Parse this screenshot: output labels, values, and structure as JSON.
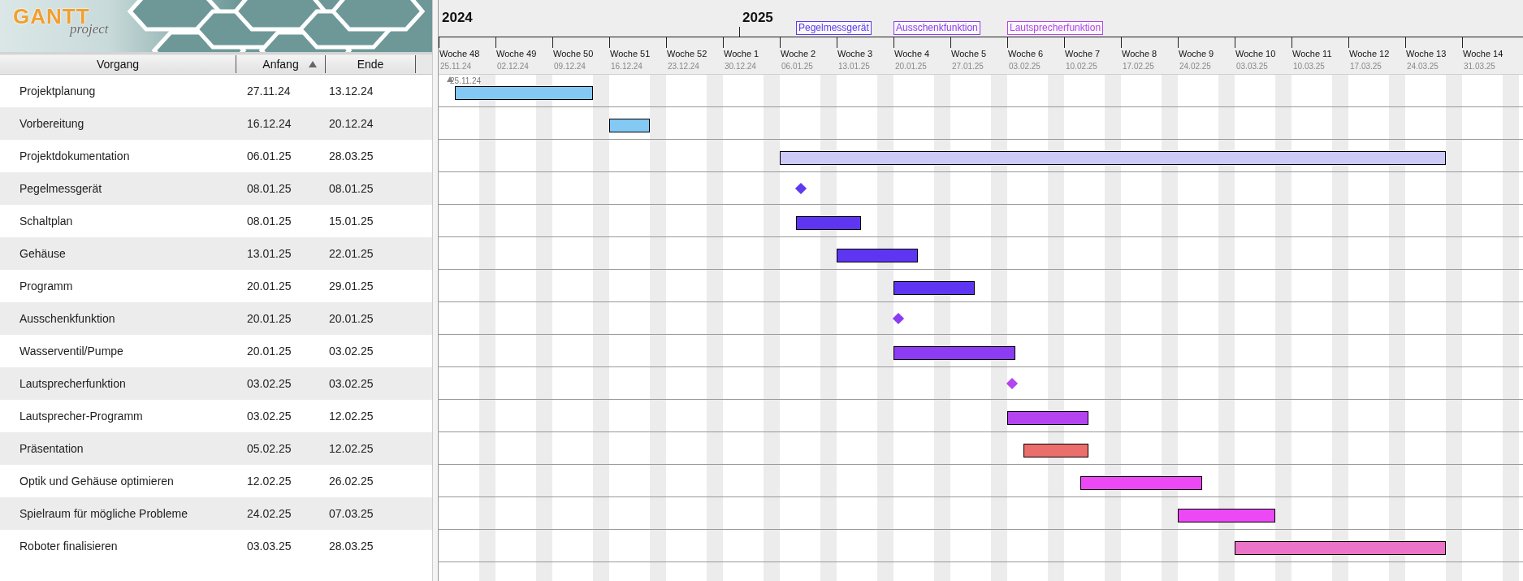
{
  "logo": {
    "title": "GANTT",
    "subtitle": "project"
  },
  "table": {
    "columns": [
      {
        "label": "Vorgang",
        "sorted": false
      },
      {
        "label": "Anfang",
        "sorted": true
      },
      {
        "label": "Ende",
        "sorted": false
      }
    ],
    "rows": [
      {
        "name": "Projektplanung",
        "start": "27.11.24",
        "end": "13.12.24",
        "kind": "task",
        "color": "#84c8f4"
      },
      {
        "name": "Vorbereitung",
        "start": "16.12.24",
        "end": "20.12.24",
        "kind": "task",
        "color": "#84c8f4"
      },
      {
        "name": "Projektdokumentation",
        "start": "06.01.25",
        "end": "28.03.25",
        "kind": "task",
        "color": "#cccaf6"
      },
      {
        "name": "Pegelmessgerät",
        "start": "08.01.25",
        "end": "08.01.25",
        "kind": "milestone",
        "color": "#5e3af0"
      },
      {
        "name": "Schaltplan",
        "start": "08.01.25",
        "end": "15.01.25",
        "kind": "task",
        "color": "#5e36f2"
      },
      {
        "name": "Gehäuse",
        "start": "13.01.25",
        "end": "22.01.25",
        "kind": "task",
        "color": "#5e36f2"
      },
      {
        "name": "Programm",
        "start": "20.01.25",
        "end": "29.01.25",
        "kind": "task",
        "color": "#5e36f2"
      },
      {
        "name": "Ausschenkfunktion",
        "start": "20.01.25",
        "end": "20.01.25",
        "kind": "milestone",
        "color": "#8c3cf0"
      },
      {
        "name": "Wasserventil/Pumpe",
        "start": "20.01.25",
        "end": "03.02.25",
        "kind": "task",
        "color": "#8c3cf2"
      },
      {
        "name": "Lautsprecherfunktion",
        "start": "03.02.25",
        "end": "03.02.25",
        "kind": "milestone",
        "color": "#b444ee"
      },
      {
        "name": "Lautsprecher-Programm",
        "start": "03.02.25",
        "end": "12.02.25",
        "kind": "task",
        "color": "#b444f0"
      },
      {
        "name": "Präsentation",
        "start": "05.02.25",
        "end": "12.02.25",
        "kind": "task",
        "color": "#ec6e6c"
      },
      {
        "name": "Optik und Gehäuse optimieren",
        "start": "12.02.25",
        "end": "26.02.25",
        "kind": "task",
        "color": "#ec48f6"
      },
      {
        "name": "Spielraum für mögliche Probleme",
        "start": "24.02.25",
        "end": "07.03.25",
        "kind": "task",
        "color": "#ec48f6"
      },
      {
        "name": "Roboter finalisieren",
        "start": "03.03.25",
        "end": "28.03.25",
        "kind": "task",
        "color": "#ec74c8"
      }
    ]
  },
  "timeline": {
    "years": [
      "2024",
      "2025"
    ],
    "milestone_labels": [
      "Pegelmessgerät",
      "Ausschenkfunktion",
      "Lautsprecherfunktion"
    ],
    "start_marker": "25.11.24",
    "weeks": [
      {
        "label": "Woche 48",
        "date": "25.11.24"
      },
      {
        "label": "Woche 49",
        "date": "02.12.24"
      },
      {
        "label": "Woche 50",
        "date": "09.12.24"
      },
      {
        "label": "Woche 51",
        "date": "16.12.24"
      },
      {
        "label": "Woche 52",
        "date": "23.12.24"
      },
      {
        "label": "Woche 1",
        "date": "30.12.24"
      },
      {
        "label": "Woche 2",
        "date": "06.01.25"
      },
      {
        "label": "Woche 3",
        "date": "13.01.25"
      },
      {
        "label": "Woche 4",
        "date": "20.01.25"
      },
      {
        "label": "Woche 5",
        "date": "27.01.25"
      },
      {
        "label": "Woche 6",
        "date": "03.02.25"
      },
      {
        "label": "Woche 7",
        "date": "10.02.25"
      },
      {
        "label": "Woche 8",
        "date": "17.02.25"
      },
      {
        "label": "Woche 9",
        "date": "24.02.25"
      },
      {
        "label": "Woche 10",
        "date": "03.03.25"
      },
      {
        "label": "Woche 11",
        "date": "10.03.25"
      },
      {
        "label": "Woche 12",
        "date": "17.03.25"
      },
      {
        "label": "Woche 13",
        "date": "24.03.25"
      },
      {
        "label": "Woche 14",
        "date": "31.03.25"
      }
    ]
  }
}
